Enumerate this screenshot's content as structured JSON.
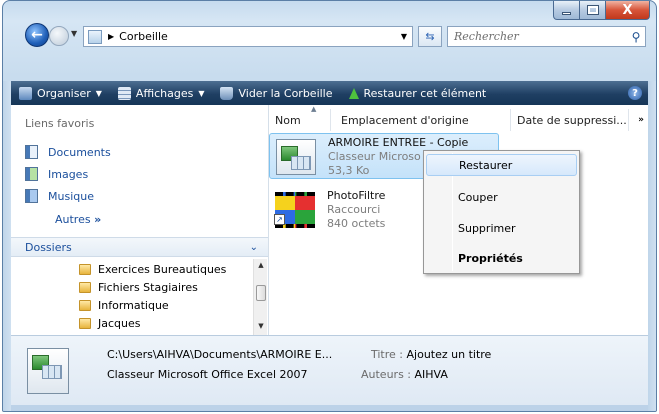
{
  "window": {
    "close_glyph": "X"
  },
  "address_bar": {
    "path": "Corbeille",
    "search_placeholder": "Rechercher"
  },
  "toolbar": {
    "organize": "Organiser",
    "views": "Affichages",
    "empty": "Vider la Corbeille",
    "restore_all": "Restaurer cet élément",
    "help": "?"
  },
  "nav": {
    "favorites_title": "Liens favoris",
    "favorites": [
      "Documents",
      "Images",
      "Musique"
    ],
    "more": "Autres",
    "folders_title": "Dossiers",
    "folders": [
      "Exercices Bureautiques",
      "Fichiers Stagiaires",
      "Informatique",
      "Jacques"
    ]
  },
  "columns": {
    "name": "Nom",
    "origin": "Emplacement d'origine",
    "deleted": "Date de suppressi...",
    "more": "»"
  },
  "files": [
    {
      "name": "ARMOIRE ENTREE - Copie",
      "type": "Classeur Microso",
      "size": "53,3 Ko",
      "icon": "excel-icon",
      "selected": true
    },
    {
      "name": "PhotoFiltre",
      "type": "Raccourci",
      "size": "840 octets",
      "icon": "photofiltre-icon",
      "selected": false
    }
  ],
  "context_menu": {
    "items": [
      "Restaurer",
      "Couper",
      "Supprimer",
      "Propriétés"
    ],
    "highlighted_index": 0,
    "default_index": 3
  },
  "details": {
    "path": "C:\\Users\\AIHVA\\Documents\\ARMOIRE E...",
    "file_type": "Classeur Microsoft Office Excel 2007",
    "title_label": "Titre :",
    "title_value": "Ajoutez un titre",
    "author_label": "Auteurs :",
    "author_value": "AIHVA"
  },
  "colors": {
    "toolbar": "#1f3f63",
    "link": "#1b4f9c",
    "selection": "#c4e2fa"
  }
}
